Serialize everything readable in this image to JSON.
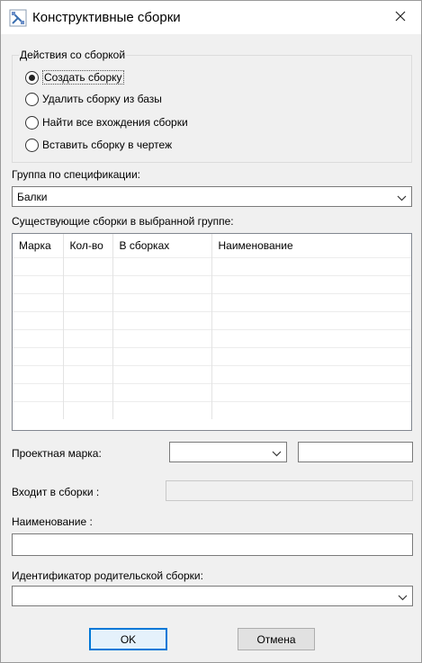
{
  "window": {
    "title": "Конструктивные сборки",
    "icon": "assembly-app-icon",
    "close_icon": "close-icon"
  },
  "actions_group": {
    "legend": "Действия со сборкой",
    "options": [
      {
        "label": "Создать сборку",
        "checked": true
      },
      {
        "label": "Удалить сборку из базы",
        "checked": false
      },
      {
        "label": "Найти все вхождения сборки",
        "checked": false
      },
      {
        "label": "Вставить сборку в чертеж",
        "checked": false
      }
    ]
  },
  "spec_group": {
    "label": "Группа по спецификации:",
    "value": "Балки"
  },
  "existing": {
    "label": "Существующие сборки в выбранной группе:",
    "columns": [
      "Марка",
      "Кол-во",
      "В сборках",
      "Наименование"
    ],
    "rows": []
  },
  "project_mark": {
    "label": "Проектная марка:",
    "combo_value": "",
    "text_value": ""
  },
  "included_in": {
    "label": "Входит в сборки :",
    "value": ""
  },
  "name": {
    "label": "Наименование :",
    "value": ""
  },
  "parent_id": {
    "label": "Идентификатор родительской сборки:",
    "value": ""
  },
  "buttons": {
    "ok": "OK",
    "cancel": "Отмена"
  },
  "colors": {
    "accent": "#0078d7",
    "window_bg": "#f0f0f0"
  }
}
